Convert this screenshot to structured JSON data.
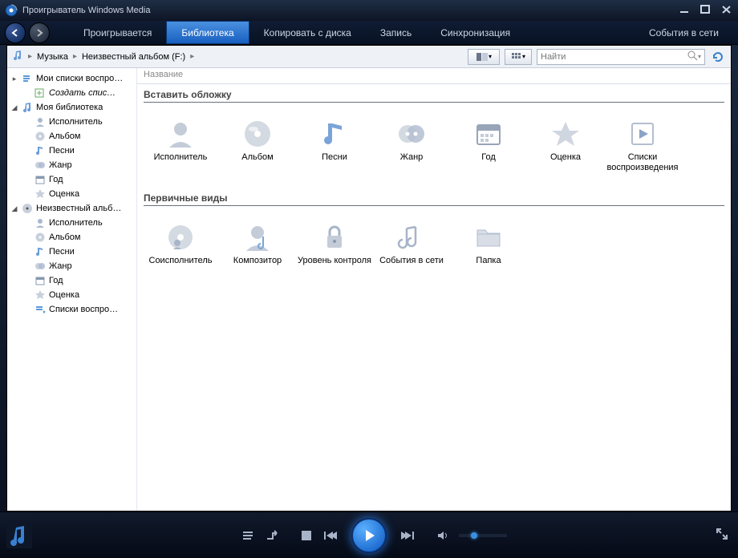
{
  "titlebar": {
    "title": "Проигрыватель Windows Media"
  },
  "tabs": {
    "now_playing": "Проигрывается",
    "library": "Библиотека",
    "rip": "Копировать с диска",
    "burn": "Запись",
    "sync": "Синхронизация",
    "online": "События в сети"
  },
  "breadcrumb": {
    "root": "Музыка",
    "path2": "Неизвестный альбом (F:)"
  },
  "search": {
    "placeholder": "Найти"
  },
  "column_header": {
    "name": "Название"
  },
  "sidebar": {
    "playlists": "Мои списки воспро…",
    "create_playlist": "Создать спис…",
    "my_library": "Моя библиотека",
    "artist": "Исполнитель",
    "album": "Альбом",
    "songs": "Песни",
    "genre": "Жанр",
    "year": "Год",
    "rating": "Оценка",
    "unknown_album": "Неизвестный альб…",
    "artist2": "Исполнитель",
    "album2": "Альбом",
    "songs2": "Песни",
    "genre2": "Жанр",
    "year2": "Год",
    "rating2": "Оценка",
    "play_lists2": "Списки воспро…"
  },
  "sections": {
    "insert_cover": "Вставить обложку",
    "primary_views": "Первичные виды"
  },
  "grid1": {
    "artist": "Исполнитель",
    "album": "Альбом",
    "songs": "Песни",
    "genre": "Жанр",
    "year": "Год",
    "rating": "Оценка",
    "playlists": "Списки воспроизведения"
  },
  "grid2": {
    "coartist": "Соисполнитель",
    "composer": "Композитор",
    "parental": "Уровень контроля",
    "online": "События в сети",
    "folder": "Папка"
  }
}
